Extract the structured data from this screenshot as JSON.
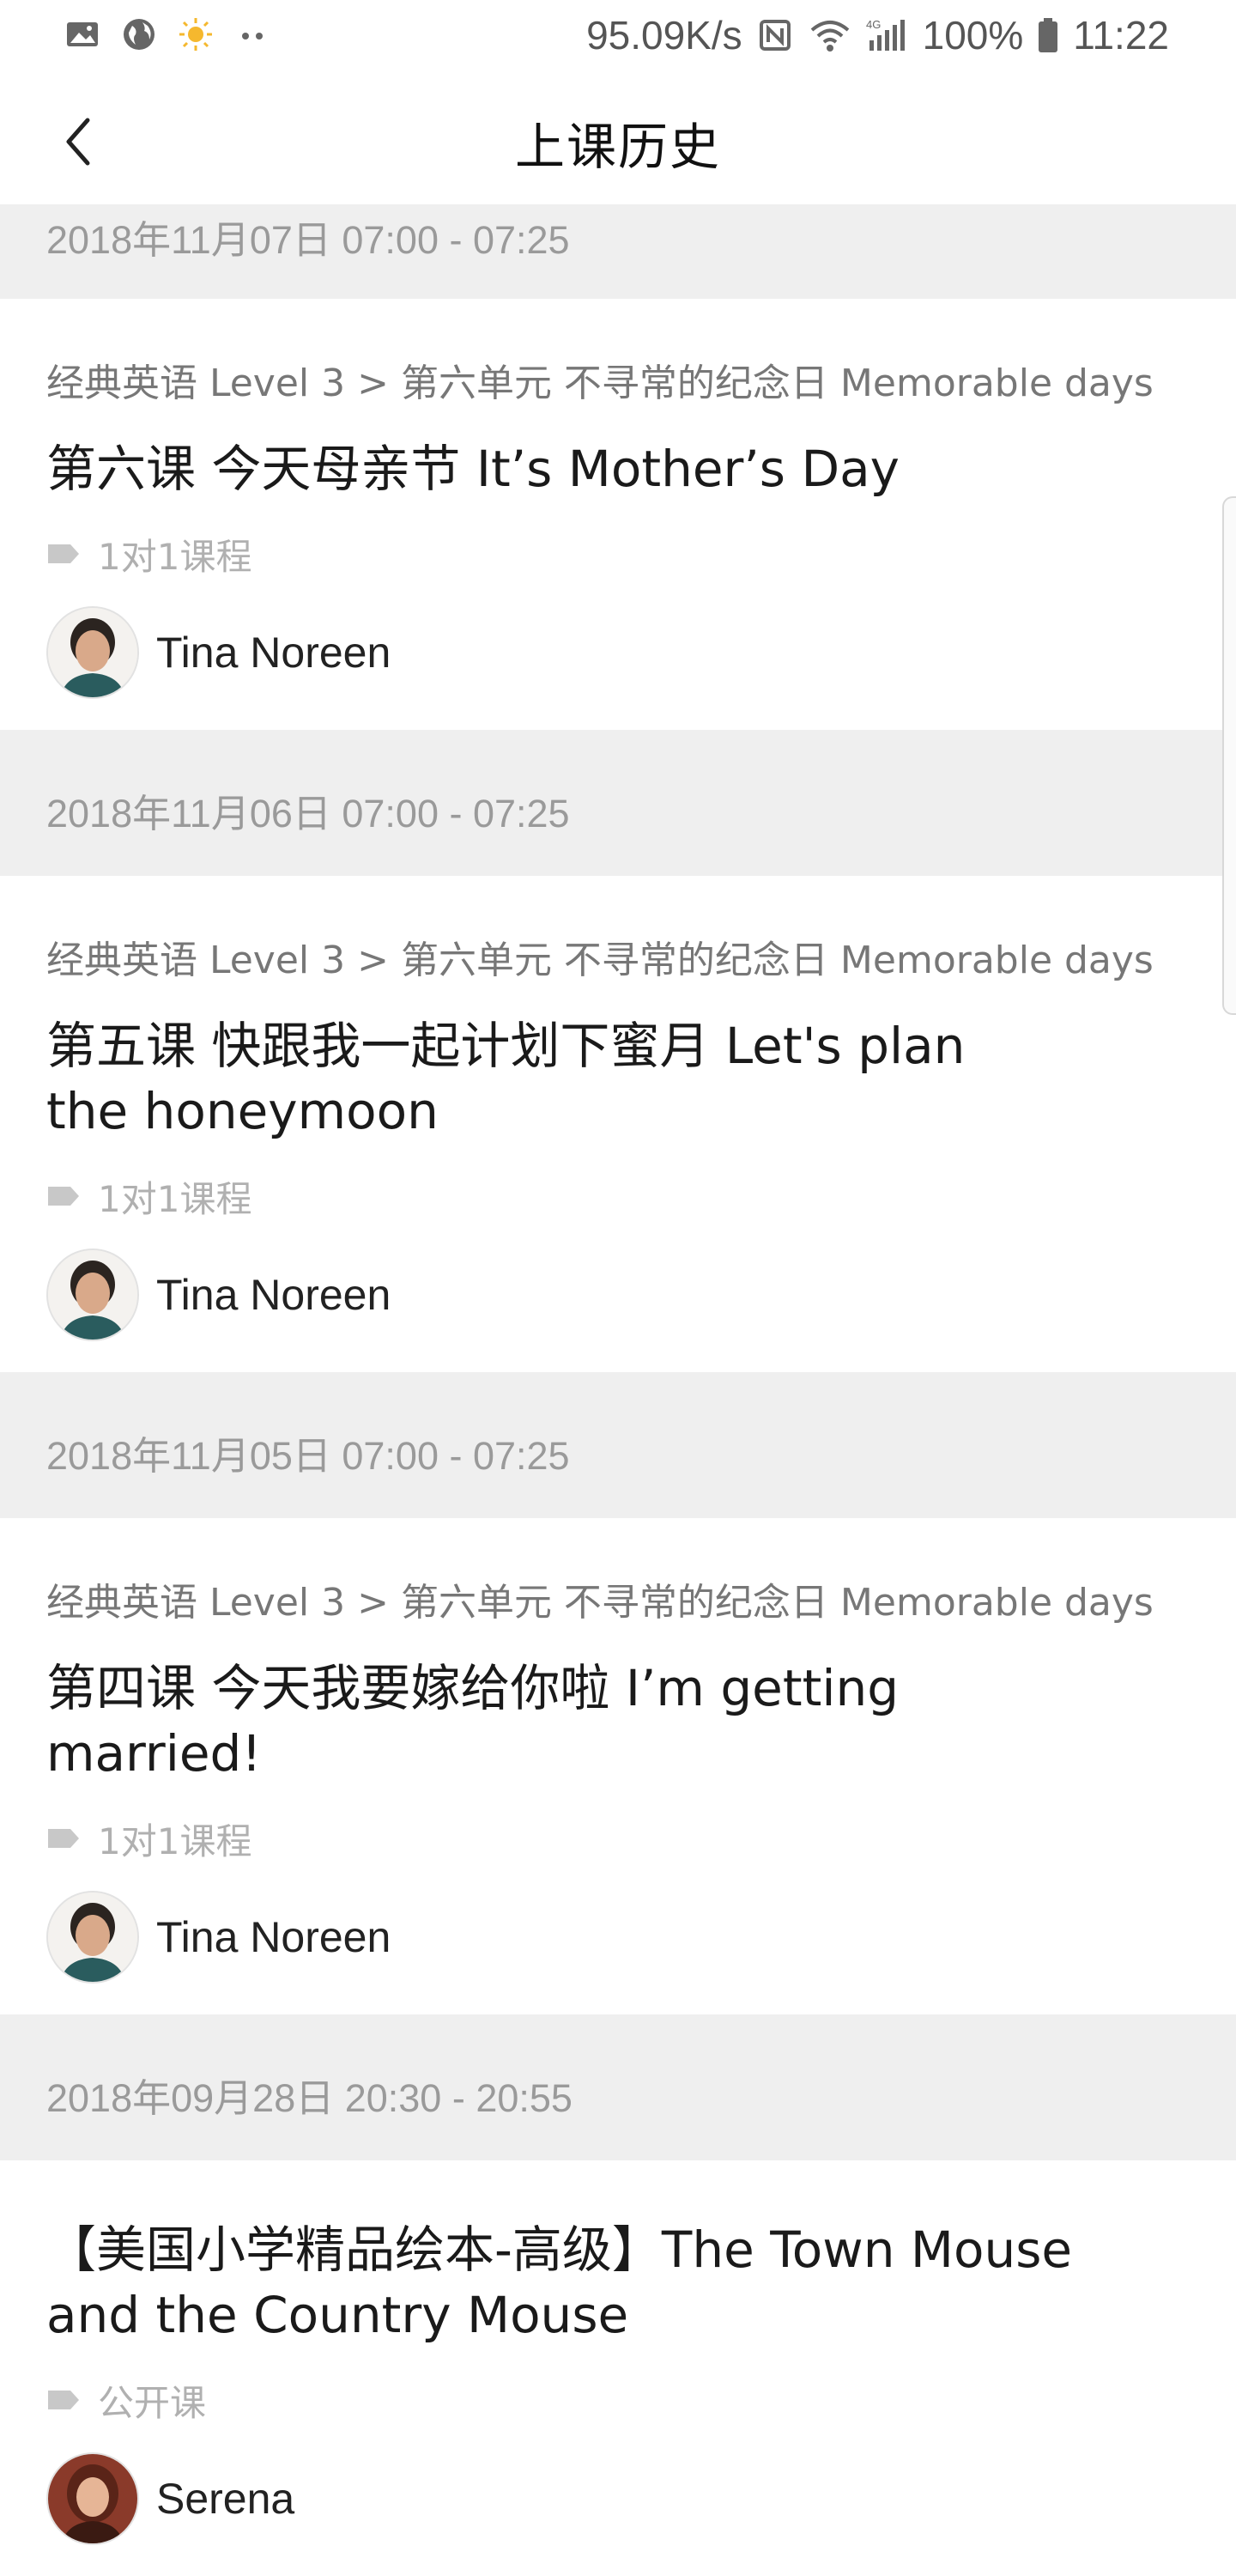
{
  "status_bar": {
    "speed": "95.09K/s",
    "battery": "100%",
    "time": "11:22",
    "network": "4G",
    "icons": [
      "image-icon",
      "globe-icon",
      "sun-icon",
      "more-dots-icon",
      "nfc-icon",
      "wifi-icon",
      "signal-icon",
      "battery-icon"
    ]
  },
  "header": {
    "title": "上课历史",
    "back_icon": "chevron-left-icon"
  },
  "sessions": [
    {
      "date": "2018年11月07日 07:00 - 07:25",
      "breadcrumb": "经典英语 Level 3 > 第六单元 不寻常的纪念日 Memorable days",
      "title": "第六课 今天母亲节 It’s Mother’s Day",
      "tag": "1对1课程",
      "teacher": "Tina Noreen"
    },
    {
      "date": "2018年11月06日 07:00 - 07:25",
      "breadcrumb": "经典英语 Level 3 > 第六单元 不寻常的纪念日 Memorable days",
      "title": "第五课 快跟我一起计划下蜜月 Let's plan the honeymoon",
      "tag": "1对1课程",
      "teacher": "Tina Noreen"
    },
    {
      "date": "2018年11月05日 07:00 - 07:25",
      "breadcrumb": "经典英语 Level 3 > 第六单元 不寻常的纪念日 Memorable days",
      "title": "第四课 今天我要嫁给你啦 I’m getting married!",
      "tag": "1对1课程",
      "teacher": "Tina Noreen"
    },
    {
      "date": "2018年09月28日 20:30 - 20:55",
      "title": "【美国小学精品绘本-高级】The Town Mouse and the Country Mouse",
      "tag": "公开课",
      "teacher": "Serena"
    }
  ],
  "colors": {
    "background": "#ffffff",
    "section_bar": "#efefef",
    "muted_text": "#9a9a9a",
    "title_text": "#1a1a1a"
  }
}
